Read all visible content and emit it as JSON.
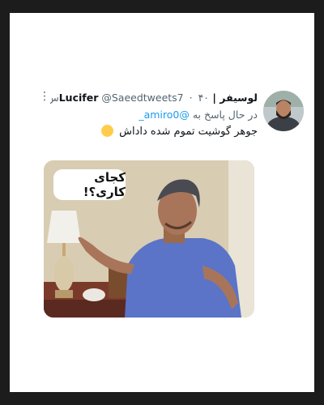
{
  "tweet": {
    "display_name": "لوسیفر | Lucifer",
    "handle": "@Saeedtweets7",
    "separator": "·",
    "time": "۴۰س",
    "more_icon": "more-vertical-icon",
    "reply_prefix": "در حال پاسخ به",
    "reply_to": "@amiro0_",
    "text": "جوهر گوشیت تموم شده داداش",
    "emoji": "rolling-on-floor-laughing",
    "media": {
      "caption": "کجای کاری؟!"
    }
  },
  "colors": {
    "background": "#1c1c1c",
    "card": "#ffffff",
    "link": "#1d9bf0",
    "secondary_text": "#536471",
    "primary_text": "#0f1419"
  }
}
